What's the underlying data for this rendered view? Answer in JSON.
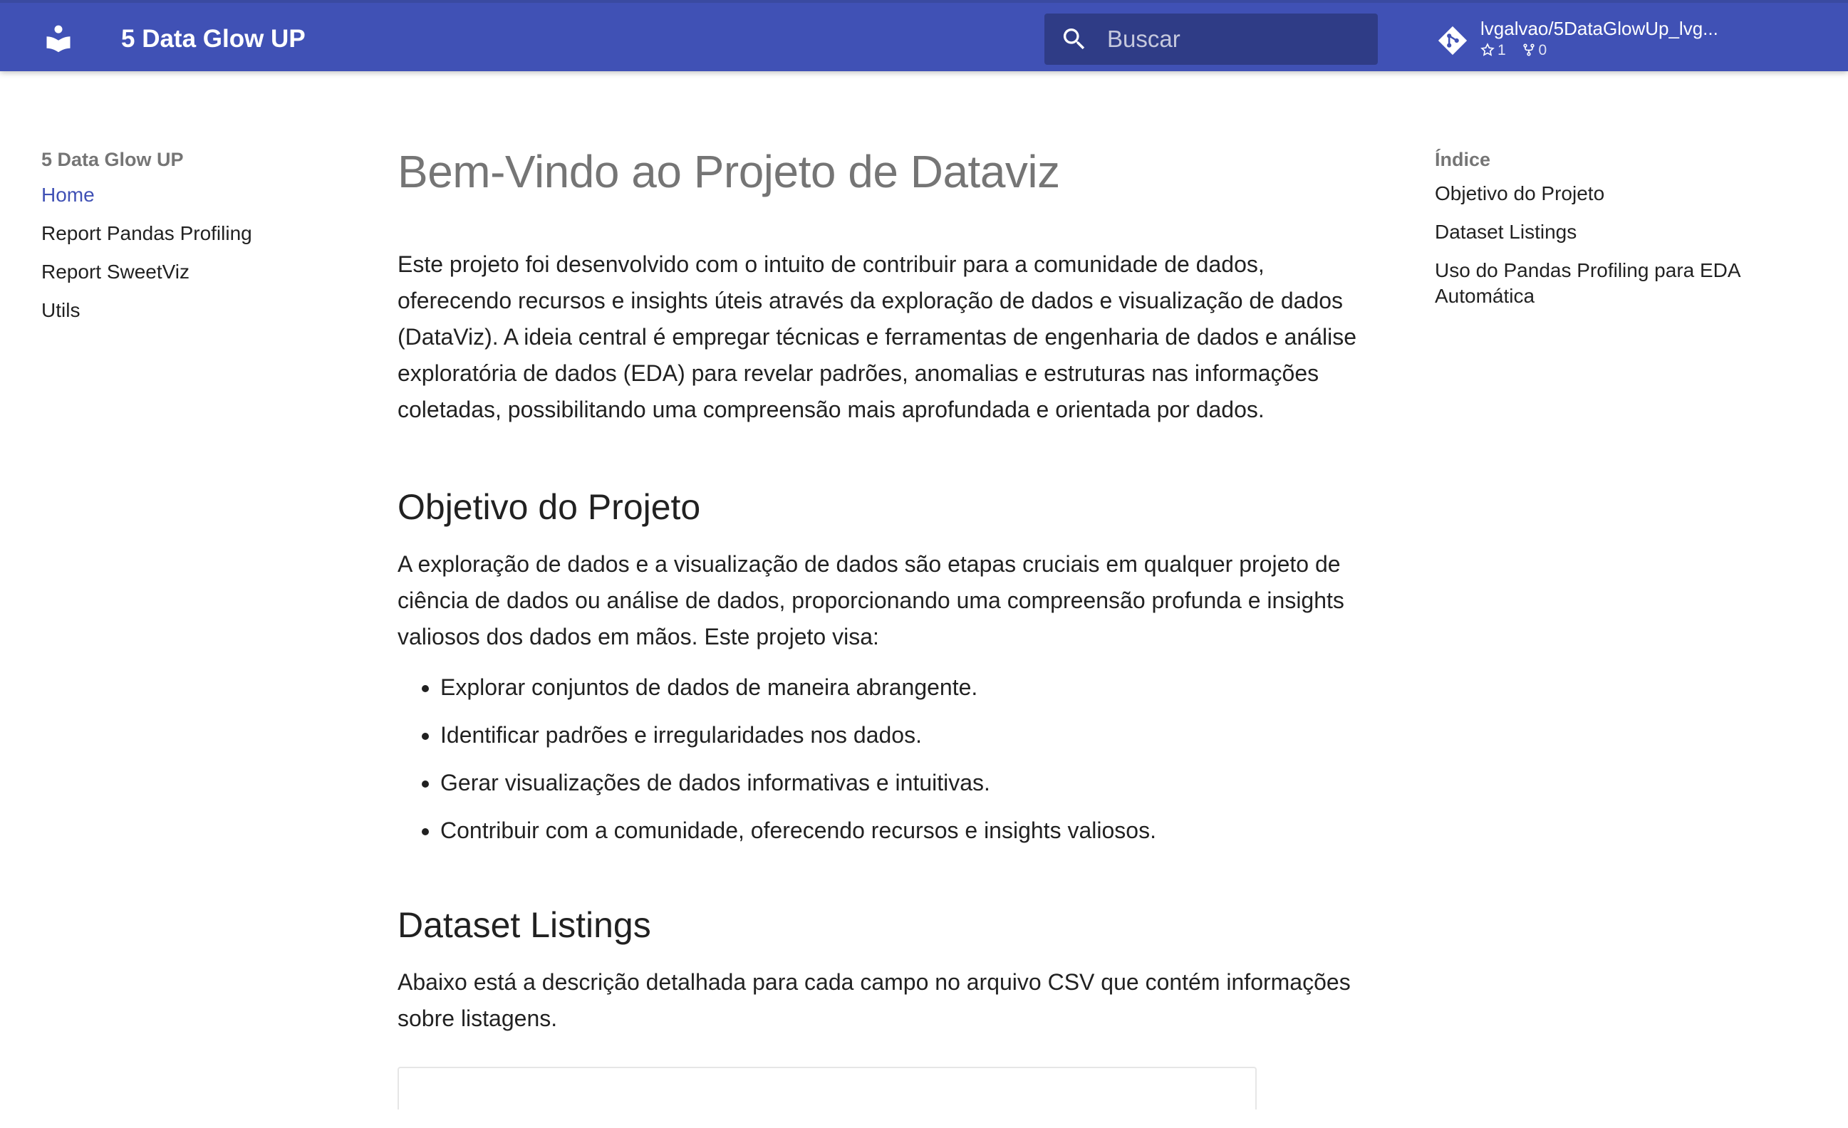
{
  "header": {
    "site_title": "5 Data Glow UP",
    "search_placeholder": "Buscar",
    "repo": {
      "name": "lvgalvao/5DataGlowUp_lvg...",
      "stars": "1",
      "forks": "0"
    },
    "logo_icon": "book-reader-icon",
    "colors": {
      "primary": "#4051b5",
      "text": "#ffffff"
    }
  },
  "nav": {
    "title": "5 Data Glow UP",
    "items": [
      {
        "label": "Home",
        "active": true
      },
      {
        "label": "Report Pandas Profiling",
        "active": false
      },
      {
        "label": "Report SweetViz",
        "active": false
      },
      {
        "label": "Utils",
        "active": false
      }
    ]
  },
  "toc": {
    "title": "Índice",
    "items": [
      {
        "label": "Objetivo do Projeto"
      },
      {
        "label": "Dataset Listings"
      },
      {
        "label": "Uso do Pandas Profiling para EDA Automática"
      }
    ]
  },
  "content": {
    "h1": "Bem-Vindo ao Projeto de Dataviz",
    "intro": "Este projeto foi desenvolvido com o intuito de contribuir para a comunidade de dados, oferecendo recursos e insights úteis através da exploração de dados e visualização de dados (DataViz). A ideia central é empregar técnicas e ferramentas de engenharia de dados e análise exploratória de dados (EDA) para revelar padrões, anomalias e estruturas nas informações coletadas, possibilitando uma compreensão mais aprofundada e orientada por dados.",
    "section1": {
      "title": "Objetivo do Projeto",
      "paragraph": "A exploração de dados e a visualização de dados são etapas cruciais em qualquer projeto de ciência de dados ou análise de dados, proporcionando uma compreensão profunda e insights valiosos dos dados em mãos. Este projeto visa:",
      "bullets": [
        "Explorar conjuntos de dados de maneira abrangente.",
        "Identificar padrões e irregularidades nos dados.",
        "Gerar visualizações de dados informativas e intuitivas.",
        "Contribuir com a comunidade, oferecendo recursos e insights valiosos."
      ]
    },
    "section2": {
      "title": "Dataset Listings",
      "paragraph": "Abaixo está a descrição detalhada para cada campo no arquivo CSV que contém informações sobre listagens."
    }
  }
}
